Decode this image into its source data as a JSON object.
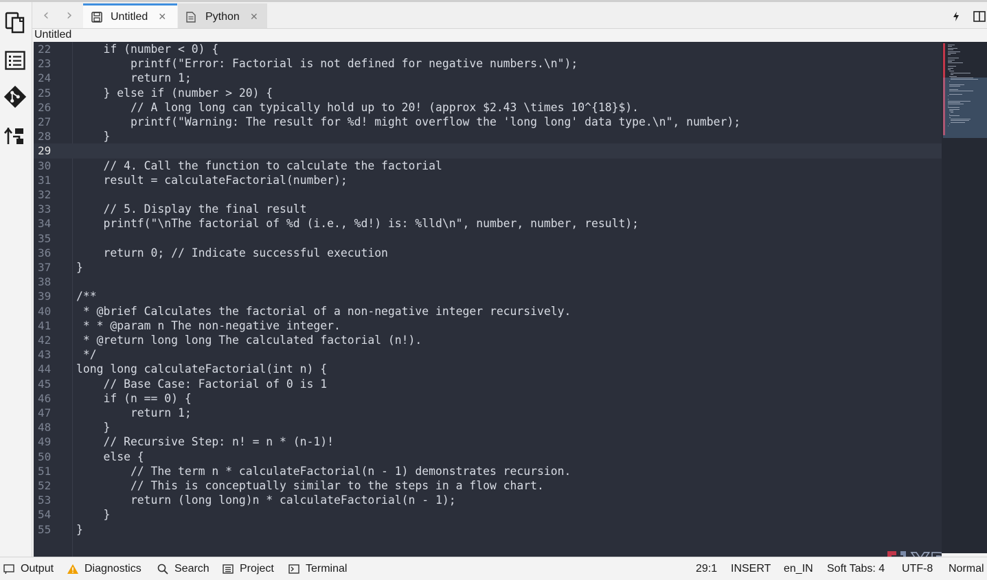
{
  "tabs": [
    {
      "label": "Untitled",
      "active": true,
      "icon": "save-icon"
    },
    {
      "label": "Python",
      "active": false,
      "icon": "file-icon"
    }
  ],
  "breadcrumb": "Untitled",
  "editor": {
    "cursor_line": 29,
    "lines": [
      {
        "n": "22",
        "text": "    if (number < 0) {"
      },
      {
        "n": "23",
        "text": "        printf(\"Error: Factorial is not defined for negative numbers.\\n\");"
      },
      {
        "n": "24",
        "text": "        return 1;"
      },
      {
        "n": "25",
        "text": "    } else if (number > 20) {"
      },
      {
        "n": "26",
        "text": "        // A long long can typically hold up to 20! (approx $2.43 \\times 10^{18}$)."
      },
      {
        "n": "27",
        "text": "        printf(\"Warning: The result for %d! might overflow the 'long long' data type.\\n\", number);"
      },
      {
        "n": "28",
        "text": "    }"
      },
      {
        "n": "29",
        "text": ""
      },
      {
        "n": "30",
        "text": "    // 4. Call the function to calculate the factorial"
      },
      {
        "n": "31",
        "text": "    result = calculateFactorial(number);"
      },
      {
        "n": "32",
        "text": ""
      },
      {
        "n": "33",
        "text": "    // 5. Display the final result"
      },
      {
        "n": "34",
        "text": "    printf(\"\\nThe factorial of %d (i.e., %d!) is: %lld\\n\", number, number, result);"
      },
      {
        "n": "35",
        "text": ""
      },
      {
        "n": "36",
        "text": "    return 0; // Indicate successful execution"
      },
      {
        "n": "37",
        "text": "}"
      },
      {
        "n": "38",
        "text": ""
      },
      {
        "n": "39",
        "text": "/**"
      },
      {
        "n": "40",
        "text": " * @brief Calculates the factorial of a non-negative integer recursively."
      },
      {
        "n": "41",
        "text": " * * @param n The non-negative integer."
      },
      {
        "n": "42",
        "text": " * @return long long The calculated factorial (n!)."
      },
      {
        "n": "43",
        "text": " */"
      },
      {
        "n": "44",
        "text": "long long calculateFactorial(int n) {"
      },
      {
        "n": "45",
        "text": "    // Base Case: Factorial of 0 is 1"
      },
      {
        "n": "46",
        "text": "    if (n == 0) {"
      },
      {
        "n": "47",
        "text": "        return 1;"
      },
      {
        "n": "48",
        "text": "    }"
      },
      {
        "n": "49",
        "text": "    // Recursive Step: n! = n * (n-1)!"
      },
      {
        "n": "50",
        "text": "    else {"
      },
      {
        "n": "51",
        "text": "        // The term n * calculateFactorial(n - 1) demonstrates recursion."
      },
      {
        "n": "52",
        "text": "        // This is conceptually similar to the steps in a flow chart."
      },
      {
        "n": "53",
        "text": "        return (long long)n * calculateFactorial(n - 1);"
      },
      {
        "n": "54",
        "text": "    }"
      },
      {
        "n": "55",
        "text": "}"
      }
    ]
  },
  "statusbar": {
    "output": "Output",
    "diagnostics": "Diagnostics",
    "search": "Search",
    "project": "Project",
    "terminal": "Terminal",
    "cursor_position": "29:1",
    "mode": "INSERT",
    "language": "en_IN",
    "indentation": "Soft Tabs: 4",
    "encoding": "UTF-8",
    "zoom": "Normal"
  },
  "watermark": "XDA",
  "colors": {
    "editor_bg": "#2b2f3a",
    "accent": "#3e8ede",
    "warning": "#f0a000",
    "watermark_red": "#c2374a"
  }
}
